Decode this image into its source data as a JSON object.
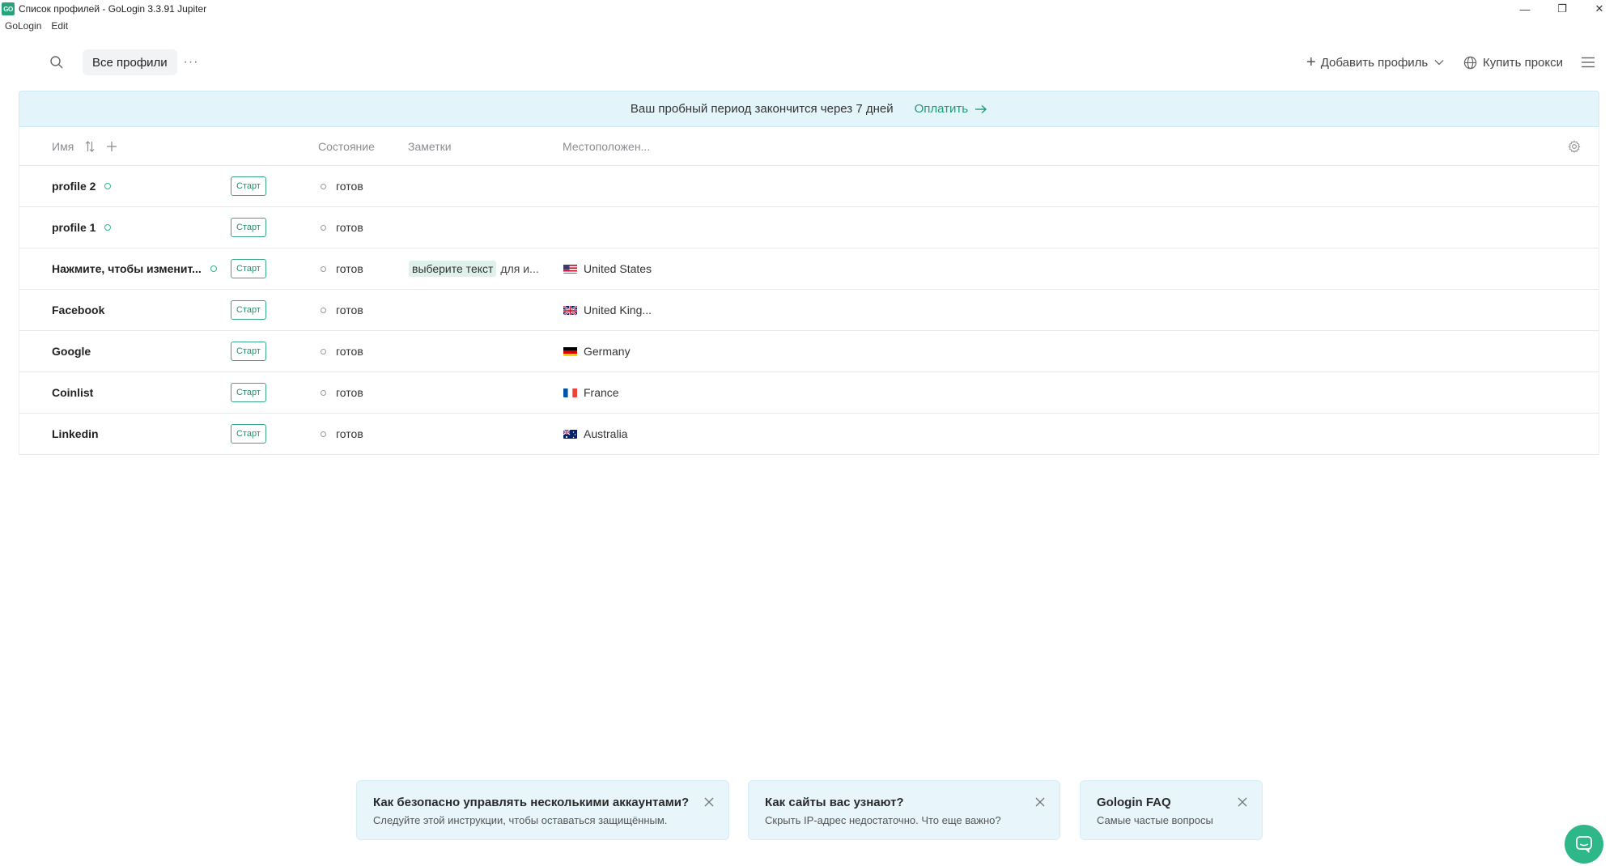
{
  "window": {
    "logo_text": "GO",
    "title": "Список профилей - GoLogin 3.3.91 Jupiter",
    "controls": {
      "minimize": "—",
      "restore": "❐",
      "close": "✕"
    }
  },
  "menubar": {
    "items": [
      "GoLogin",
      "Edit"
    ]
  },
  "toolbar": {
    "filter_label": "Все профили",
    "more_label": "···",
    "add_profile_label": "Добавить профиль",
    "buy_proxy_label": "Купить прокси"
  },
  "banner": {
    "text": "Ваш пробный период закончится через 7 дней",
    "link": "Оплатить"
  },
  "table": {
    "columns": {
      "name": "Имя",
      "status": "Состояние",
      "notes": "Заметки",
      "location": "Местоположен..."
    },
    "start_label": "Старт",
    "rows": [
      {
        "name": "profile 2",
        "online": true,
        "status": "готов",
        "notes_highlight": "",
        "notes_rest": "",
        "location": "",
        "flag": ""
      },
      {
        "name": "profile 1",
        "online": true,
        "status": "готов",
        "notes_highlight": "",
        "notes_rest": "",
        "location": "",
        "flag": ""
      },
      {
        "name": "Нажмите, чтобы изменит...",
        "online": true,
        "status": "готов",
        "notes_highlight": "выберите текст",
        "notes_rest": "для и...",
        "location": "United States",
        "flag": "us"
      },
      {
        "name": "Facebook",
        "online": false,
        "status": "готов",
        "notes_highlight": "",
        "notes_rest": "",
        "location": "United King...",
        "flag": "gb"
      },
      {
        "name": "Google",
        "online": false,
        "status": "готов",
        "notes_highlight": "",
        "notes_rest": "",
        "location": "Germany",
        "flag": "de"
      },
      {
        "name": "Coinlist",
        "online": false,
        "status": "готов",
        "notes_highlight": "",
        "notes_rest": "",
        "location": "France",
        "flag": "fr"
      },
      {
        "name": "Linkedin",
        "online": false,
        "status": "готов",
        "notes_highlight": "",
        "notes_rest": "",
        "location": "Australia",
        "flag": "au"
      }
    ]
  },
  "tips": [
    {
      "title": "Как безопасно управлять несколькими аккаунтами?",
      "subtitle": "Следуйте этой инструкции, чтобы оставаться защищённым."
    },
    {
      "title": "Как сайты вас узнают?",
      "subtitle": "Скрыть IP-адрес недостаточно. Что еще важно?"
    },
    {
      "title": "Gologin FAQ",
      "subtitle": "Самые частые вопросы"
    }
  ],
  "colors": {
    "accent": "#2eb88a",
    "banner_bg": "#e3f4fb",
    "tip_bg": "#e8f6fb"
  }
}
